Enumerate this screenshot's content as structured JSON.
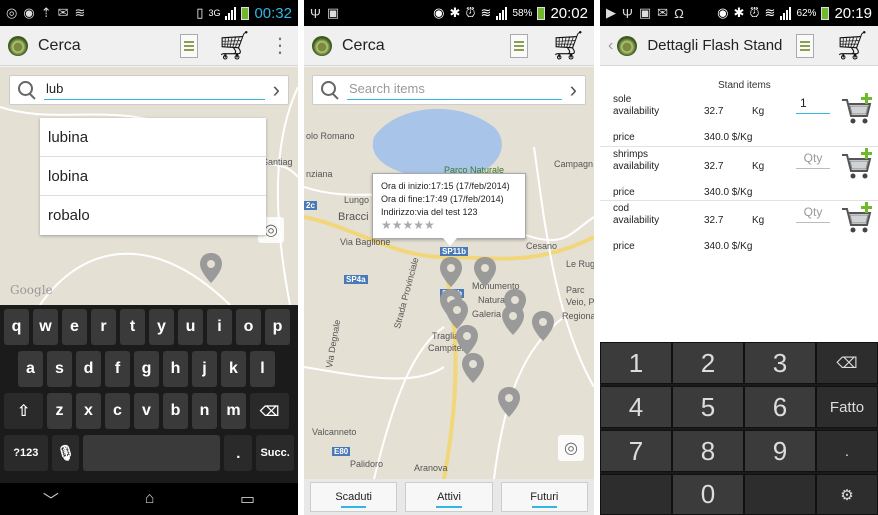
{
  "screen1": {
    "status": {
      "time": "00:32",
      "network": "3G"
    },
    "actionbar": {
      "title": "Cerca"
    },
    "search": {
      "value": "lub"
    },
    "suggestions": [
      "lubina",
      "lobina",
      "robalo"
    ],
    "map": {
      "label_santiago": "Santiag",
      "google": "Google"
    },
    "keyboard": {
      "row1": [
        "q",
        "w",
        "e",
        "r",
        "t",
        "y",
        "u",
        "i",
        "o",
        "p"
      ],
      "row2": [
        "a",
        "s",
        "d",
        "f",
        "g",
        "h",
        "j",
        "k",
        "l"
      ],
      "row3": [
        "z",
        "x",
        "c",
        "v",
        "b",
        "n",
        "m"
      ],
      "symbols": "?123",
      "dot": ".",
      "next": "Succ."
    }
  },
  "screen2": {
    "status": {
      "time": "20:02",
      "battery": "58%"
    },
    "actionbar": {
      "title": "Cerca"
    },
    "search": {
      "placeholder": "Search items"
    },
    "info": {
      "start": "Ora di inizio:17:15 (17/feb/2014)",
      "end": "Ora di fine:17:49 (17/feb/2014)",
      "address": "Indirizzo:via del test 123",
      "stars": "★★★★★"
    },
    "map": {
      "labels": {
        "lago": "olo Romano",
        "parco": "Parco Naturale",
        "campagna": "Campagn",
        "anziana": "nziana",
        "lungo": "Lungo",
        "bracci": "Bracci",
        "viabaglione": "Via Baglione",
        "cesano": "Cesano",
        "laruge": "Le Ruge",
        "monumento": "Monumento",
        "naturale": "Naturale di",
        "galeria": "Galeria Anti",
        "trag": "Tragliata",
        "campitello": "Campitello",
        "veio": "Parc",
        "veio2": "Veio, P",
        "regiona": "Regiona",
        "valcanneto": "Valcanneto",
        "palidoro": "Palidoro",
        "aranova": "Aranova",
        "viaosp": "Via Degnale",
        "strada": "Strada Provinciale"
      },
      "shields": [
        "SP11b",
        "SP4a",
        "SP4b",
        "E80",
        "2c"
      ]
    },
    "tabs": [
      "Scaduti",
      "Attivi",
      "Futuri"
    ]
  },
  "screen3": {
    "status": {
      "time": "20:19",
      "battery": "62%"
    },
    "actionbar": {
      "title": "Dettagli Flash Stand"
    },
    "heading": "Stand items",
    "items": [
      {
        "name": "sole",
        "availability_label": "availability",
        "availability": "32.7",
        "unit": "Kg",
        "field": "1",
        "price_label": "price",
        "price": "340.0 $/Kg"
      },
      {
        "name": "shrimps",
        "availability_label": "availability",
        "availability": "32.7",
        "unit": "Kg",
        "field": "Qty",
        "price_label": "price",
        "price": "340.0 $/Kg"
      },
      {
        "name": "cod",
        "availability_label": "availability",
        "availability": "32.7",
        "unit": "Kg",
        "field": "Qty",
        "price_label": "price",
        "price": "340.0 $/Kg"
      }
    ],
    "numpad": {
      "keys": [
        "1",
        "2",
        "3",
        "4",
        "5",
        "6",
        "7",
        "8",
        "9",
        "0"
      ],
      "done": "Fatto",
      "dot": "."
    }
  },
  "colors": {
    "accent": "#33b5e5",
    "statusbar": "#000000",
    "map": "#e4e0d4",
    "pin": "#9a9a9a",
    "cart_plus": "#6fba2c"
  }
}
